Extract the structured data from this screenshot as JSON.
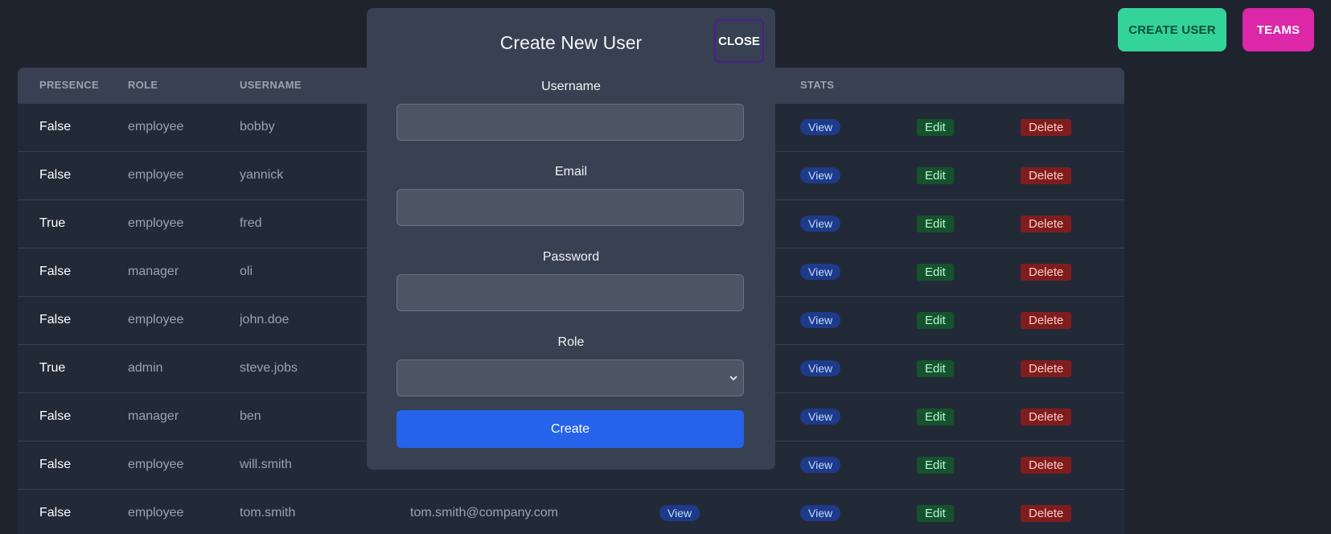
{
  "header": {
    "create_user_label": "CREATE USER",
    "teams_label": "TEAMS"
  },
  "table": {
    "columns": [
      "PRESENCE",
      "ROLE",
      "USERNAME",
      "",
      "",
      "STATS",
      "",
      ""
    ],
    "view_label": "View",
    "edit_label": "Edit",
    "delete_label": "Delete",
    "rows": [
      {
        "presence": "False",
        "role": "employee",
        "username": "bobby",
        "email": ""
      },
      {
        "presence": "False",
        "role": "employee",
        "username": "yannick",
        "email": ""
      },
      {
        "presence": "True",
        "role": "employee",
        "username": "fred",
        "email": ""
      },
      {
        "presence": "False",
        "role": "manager",
        "username": "oli",
        "email": ""
      },
      {
        "presence": "False",
        "role": "employee",
        "username": "john.doe",
        "email": ""
      },
      {
        "presence": "True",
        "role": "admin",
        "username": "steve.jobs",
        "email": ""
      },
      {
        "presence": "False",
        "role": "manager",
        "username": "ben",
        "email": ""
      },
      {
        "presence": "False",
        "role": "employee",
        "username": "will.smith",
        "email": ""
      },
      {
        "presence": "False",
        "role": "employee",
        "username": "tom.smith",
        "email": "tom.smith@company.com"
      }
    ]
  },
  "modal": {
    "title": "Create New User",
    "close_label": "CLOSE",
    "username_label": "Username",
    "username_value": "",
    "email_label": "Email",
    "email_value": "",
    "password_label": "Password",
    "password_value": "",
    "role_label": "Role",
    "role_value": "",
    "submit_label": "Create"
  },
  "colors": {
    "background": "#1e232d",
    "create_user_button": "#34d399",
    "teams_button": "#db27a8",
    "modal": "#374151",
    "create_button": "#2563eb"
  }
}
